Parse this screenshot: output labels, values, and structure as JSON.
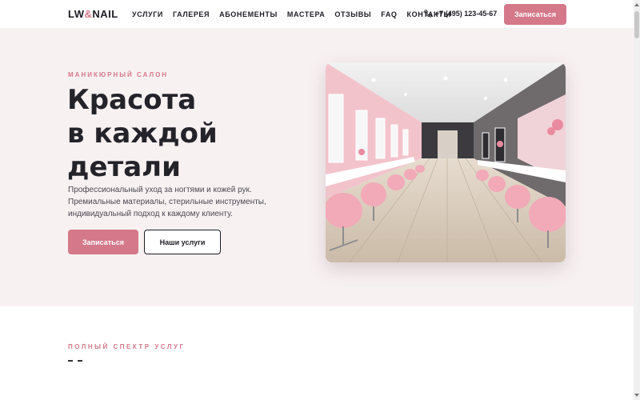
{
  "header": {
    "logo_left": "LW",
    "logo_amp": "&",
    "logo_right": "NAIL",
    "nav": [
      "УСЛУГИ",
      "ГАЛЕРЕЯ",
      "АБОНЕМЕНТЫ",
      "МАСТЕРА",
      "ОТЗЫВЫ",
      "FAQ",
      "КОНТАКТЫ"
    ],
    "phone": "+7 (495) 123-45-67",
    "cta": "Записаться"
  },
  "hero": {
    "eyebrow": "МАНИКЮРНЫЙ САЛОН",
    "title_lines": [
      "Красота",
      "в каждой",
      "детали"
    ],
    "description_lines": [
      "Профессиональный уход за ногтями и кожей рук.",
      "Премиальные материалы, стерильные инструменты,",
      "индивидуальный подход к каждому клиенту."
    ],
    "primary_button": "Записаться",
    "secondary_button": "Наши услуги"
  },
  "services": {
    "eyebrow": "ПОЛНЫЙ СПЕКТР УСЛУГ"
  },
  "colors": {
    "accent": "#d4788a",
    "hero_bg": "#f8f1f2",
    "text_dark": "#1d1d24"
  },
  "icons": {
    "phone": "phone-icon"
  }
}
